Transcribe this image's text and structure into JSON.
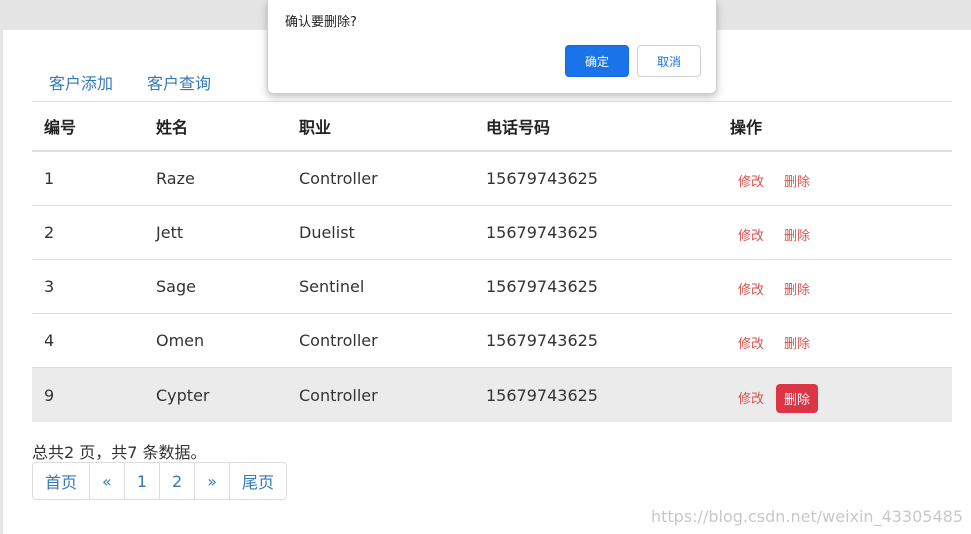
{
  "dialog": {
    "message": "确认要删除?",
    "ok_label": "确定",
    "cancel_label": "取消",
    "ok_color": "#1a73e8"
  },
  "nav": {
    "tabs": [
      {
        "label": "客户添加"
      },
      {
        "label": "客户查询"
      }
    ]
  },
  "table": {
    "headers": [
      "编号",
      "姓名",
      "职业",
      "电话号码",
      "操作"
    ],
    "rows": [
      {
        "id": "1",
        "name": "Raze",
        "job": "Controller",
        "phone": "15679743625",
        "edit": "修改",
        "del": "删除"
      },
      {
        "id": "2",
        "name": "Jett",
        "job": "Duelist",
        "phone": "15679743625",
        "edit": "修改",
        "del": "删除"
      },
      {
        "id": "3",
        "name": "Sage",
        "job": "Sentinel",
        "phone": "15679743625",
        "edit": "修改",
        "del": "删除"
      },
      {
        "id": "4",
        "name": "Omen",
        "job": "Controller",
        "phone": "15679743625",
        "edit": "修改",
        "del": "删除"
      },
      {
        "id": "9",
        "name": "Cypter",
        "job": "Controller",
        "phone": "15679743625",
        "edit": "修改",
        "del": "删除"
      }
    ],
    "action_color": "#d9534f",
    "active_delete_color": "#dc3545"
  },
  "footer": {
    "summary": "总共2 页，共7 条数据。",
    "pager": [
      "首页",
      "«",
      "1",
      "2",
      "»",
      "尾页"
    ]
  },
  "watermark": "https://blog.csdn.net/weixin_43305485"
}
